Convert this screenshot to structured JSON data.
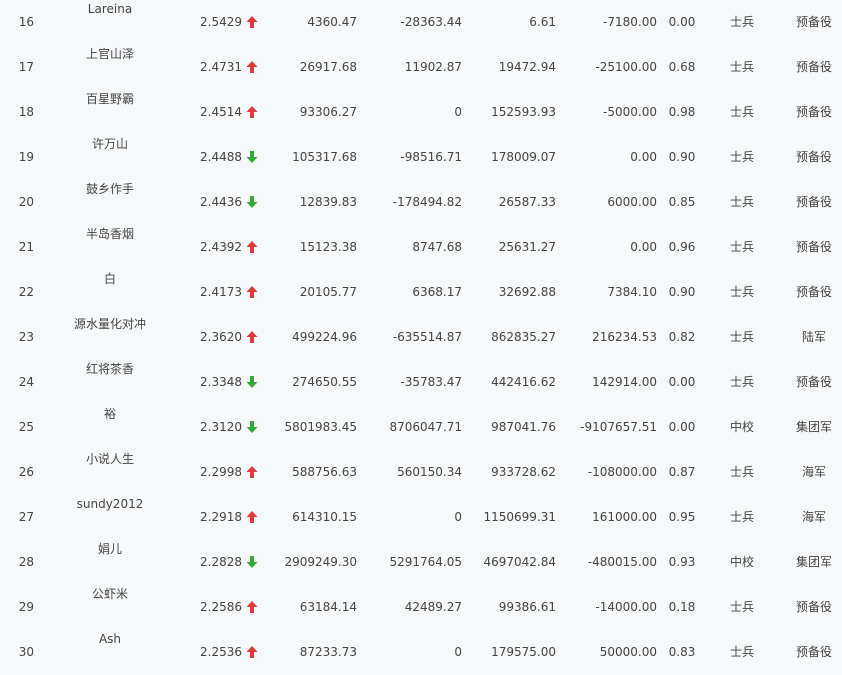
{
  "colors": {
    "up": "#e23a3a",
    "down": "#35a935",
    "text": "#444444",
    "background": "#f6f8fa"
  },
  "rows": [
    {
      "rank": "16",
      "name": "Lareina",
      "score": "2.5429",
      "trend": "up",
      "v1": "4360.47",
      "v2": "-28363.44",
      "v3": "6.61",
      "v4": "-7180.00",
      "ratio": "0.00",
      "rank_title": "士兵",
      "service": "预备役"
    },
    {
      "rank": "17",
      "name": "上官山泽",
      "score": "2.4731",
      "trend": "up",
      "v1": "26917.68",
      "v2": "11902.87",
      "v3": "19472.94",
      "v4": "-25100.00",
      "ratio": "0.68",
      "rank_title": "士兵",
      "service": "预备役"
    },
    {
      "rank": "18",
      "name": "百星野霸",
      "score": "2.4514",
      "trend": "up",
      "v1": "93306.27",
      "v2": "0",
      "v3": "152593.93",
      "v4": "-5000.00",
      "ratio": "0.98",
      "rank_title": "士兵",
      "service": "预备役"
    },
    {
      "rank": "19",
      "name": "许万山",
      "score": "2.4488",
      "trend": "down",
      "v1": "105317.68",
      "v2": "-98516.71",
      "v3": "178009.07",
      "v4": "0.00",
      "ratio": "0.90",
      "rank_title": "士兵",
      "service": "预备役"
    },
    {
      "rank": "20",
      "name": "鼓乡作手",
      "score": "2.4436",
      "trend": "down",
      "v1": "12839.83",
      "v2": "-178494.82",
      "v3": "26587.33",
      "v4": "6000.00",
      "ratio": "0.85",
      "rank_title": "士兵",
      "service": "预备役"
    },
    {
      "rank": "21",
      "name": "半岛香烟",
      "score": "2.4392",
      "trend": "up",
      "v1": "15123.38",
      "v2": "8747.68",
      "v3": "25631.27",
      "v4": "0.00",
      "ratio": "0.96",
      "rank_title": "士兵",
      "service": "预备役"
    },
    {
      "rank": "22",
      "name": "白",
      "score": "2.4173",
      "trend": "up",
      "v1": "20105.77",
      "v2": "6368.17",
      "v3": "32692.88",
      "v4": "7384.10",
      "ratio": "0.90",
      "rank_title": "士兵",
      "service": "预备役"
    },
    {
      "rank": "23",
      "name": "源水量化对冲",
      "score": "2.3620",
      "trend": "up",
      "v1": "499224.96",
      "v2": "-635514.87",
      "v3": "862835.27",
      "v4": "216234.53",
      "ratio": "0.82",
      "rank_title": "士兵",
      "service": "陆军"
    },
    {
      "rank": "24",
      "name": "红将茶香",
      "score": "2.3348",
      "trend": "down",
      "v1": "274650.55",
      "v2": "-35783.47",
      "v3": "442416.62",
      "v4": "142914.00",
      "ratio": "0.00",
      "rank_title": "士兵",
      "service": "预备役"
    },
    {
      "rank": "25",
      "name": "裕",
      "score": "2.3120",
      "trend": "down",
      "v1": "5801983.45",
      "v2": "8706047.71",
      "v3": "987041.76",
      "v4": "-9107657.51",
      "ratio": "0.00",
      "rank_title": "中校",
      "service": "集团军"
    },
    {
      "rank": "26",
      "name": "小说人生",
      "score": "2.2998",
      "trend": "up",
      "v1": "588756.63",
      "v2": "560150.34",
      "v3": "933728.62",
      "v4": "-108000.00",
      "ratio": "0.87",
      "rank_title": "士兵",
      "service": "海军"
    },
    {
      "rank": "27",
      "name": "sundy2012",
      "score": "2.2918",
      "trend": "up",
      "v1": "614310.15",
      "v2": "0",
      "v3": "1150699.31",
      "v4": "161000.00",
      "ratio": "0.95",
      "rank_title": "士兵",
      "service": "海军"
    },
    {
      "rank": "28",
      "name": "娟儿",
      "score": "2.2828",
      "trend": "down",
      "v1": "2909249.30",
      "v2": "5291764.05",
      "v3": "4697042.84",
      "v4": "-480015.00",
      "ratio": "0.93",
      "rank_title": "中校",
      "service": "集团军"
    },
    {
      "rank": "29",
      "name": "公虾米",
      "score": "2.2586",
      "trend": "up",
      "v1": "63184.14",
      "v2": "42489.27",
      "v3": "99386.61",
      "v4": "-14000.00",
      "ratio": "0.18",
      "rank_title": "士兵",
      "service": "预备役"
    },
    {
      "rank": "30",
      "name": "Ash",
      "score": "2.2536",
      "trend": "up",
      "v1": "87233.73",
      "v2": "0",
      "v3": "179575.00",
      "v4": "50000.00",
      "ratio": "0.83",
      "rank_title": "士兵",
      "service": "预备役"
    }
  ]
}
